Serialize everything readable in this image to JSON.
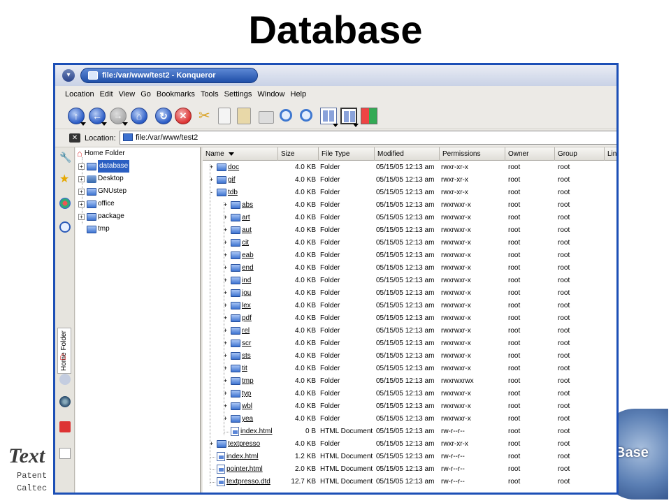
{
  "slide": {
    "title": "Database",
    "bg_left_logo": "Text",
    "bg_left_line1": "Patent",
    "bg_left_line2": "Caltec",
    "bg_right_logo": "Base"
  },
  "window": {
    "title": "file:/var/www/test2 - Konqueror",
    "menu": [
      "Location",
      "Edit",
      "View",
      "Go",
      "Bookmarks",
      "Tools",
      "Settings",
      "Window",
      "Help"
    ],
    "location_label": "Location:",
    "location_value": "file:/var/www/test2",
    "toolbar_icons": [
      "up-icon",
      "back-icon",
      "forward-icon",
      "home-icon",
      "reload-icon",
      "stop-icon",
      "cut-icon",
      "copy-icon",
      "paste-icon",
      "print-icon",
      "zoom-in-icon",
      "zoom-out-icon",
      "icon-view-icon",
      "tree-view-icon",
      "color-view-icon"
    ]
  },
  "sidebar": {
    "tab_label": "Home Folder",
    "root": "Home Folder",
    "items": [
      {
        "label": "database",
        "selected": true
      },
      {
        "label": "Desktop",
        "selected": false
      },
      {
        "label": "GNUstep",
        "selected": false
      },
      {
        "label": "office",
        "selected": false
      },
      {
        "label": "package",
        "selected": false
      },
      {
        "label": "tmp",
        "selected": false
      }
    ]
  },
  "files": {
    "columns": [
      "Name",
      "Size",
      "File Type",
      "Modified",
      "Permissions",
      "Owner",
      "Group",
      "Lin"
    ],
    "rows": [
      {
        "name": "doc",
        "size": "4.0 KB",
        "type": "Folder",
        "modified": "05/15/05 12:13 am",
        "perms": "rwxr-xr-x",
        "owner": "root",
        "group": "root",
        "level": 0,
        "kind": "folder",
        "exp": "+"
      },
      {
        "name": "gif",
        "size": "4.0 KB",
        "type": "Folder",
        "modified": "05/15/05 12:13 am",
        "perms": "rwxr-xr-x",
        "owner": "root",
        "group": "root",
        "level": 0,
        "kind": "folder",
        "exp": "+"
      },
      {
        "name": "tdb",
        "size": "4.0 KB",
        "type": "Folder",
        "modified": "05/15/05 12:13 am",
        "perms": "rwxr-xr-x",
        "owner": "root",
        "group": "root",
        "level": 0,
        "kind": "folder",
        "exp": "-"
      },
      {
        "name": "abs",
        "size": "4.0 KB",
        "type": "Folder",
        "modified": "05/15/05 12:13 am",
        "perms": "rwxrwxr-x",
        "owner": "root",
        "group": "root",
        "level": 1,
        "kind": "folder",
        "exp": "+"
      },
      {
        "name": "art",
        "size": "4.0 KB",
        "type": "Folder",
        "modified": "05/15/05 12:13 am",
        "perms": "rwxrwxr-x",
        "owner": "root",
        "group": "root",
        "level": 1,
        "kind": "folder",
        "exp": "+"
      },
      {
        "name": "aut",
        "size": "4.0 KB",
        "type": "Folder",
        "modified": "05/15/05 12:13 am",
        "perms": "rwxrwxr-x",
        "owner": "root",
        "group": "root",
        "level": 1,
        "kind": "folder",
        "exp": "+"
      },
      {
        "name": "cit",
        "size": "4.0 KB",
        "type": "Folder",
        "modified": "05/15/05 12:13 am",
        "perms": "rwxrwxr-x",
        "owner": "root",
        "group": "root",
        "level": 1,
        "kind": "folder",
        "exp": "+"
      },
      {
        "name": "eab",
        "size": "4.0 KB",
        "type": "Folder",
        "modified": "05/15/05 12:13 am",
        "perms": "rwxrwxr-x",
        "owner": "root",
        "group": "root",
        "level": 1,
        "kind": "folder",
        "exp": "+"
      },
      {
        "name": "end",
        "size": "4.0 KB",
        "type": "Folder",
        "modified": "05/15/05 12:13 am",
        "perms": "rwxrwxr-x",
        "owner": "root",
        "group": "root",
        "level": 1,
        "kind": "folder",
        "exp": "+"
      },
      {
        "name": "ind",
        "size": "4.0 KB",
        "type": "Folder",
        "modified": "05/15/05 12:13 am",
        "perms": "rwxrwxr-x",
        "owner": "root",
        "group": "root",
        "level": 1,
        "kind": "folder",
        "exp": "+"
      },
      {
        "name": "jou",
        "size": "4.0 KB",
        "type": "Folder",
        "modified": "05/15/05 12:13 am",
        "perms": "rwxrwxr-x",
        "owner": "root",
        "group": "root",
        "level": 1,
        "kind": "folder",
        "exp": "+"
      },
      {
        "name": "lex",
        "size": "4.0 KB",
        "type": "Folder",
        "modified": "05/15/05 12:13 am",
        "perms": "rwxrwxr-x",
        "owner": "root",
        "group": "root",
        "level": 1,
        "kind": "folder",
        "exp": "+"
      },
      {
        "name": "pdf",
        "size": "4.0 KB",
        "type": "Folder",
        "modified": "05/15/05 12:13 am",
        "perms": "rwxrwxr-x",
        "owner": "root",
        "group": "root",
        "level": 1,
        "kind": "folder",
        "exp": "+"
      },
      {
        "name": "rel",
        "size": "4.0 KB",
        "type": "Folder",
        "modified": "05/15/05 12:13 am",
        "perms": "rwxrwxr-x",
        "owner": "root",
        "group": "root",
        "level": 1,
        "kind": "folder",
        "exp": "+"
      },
      {
        "name": "scr",
        "size": "4.0 KB",
        "type": "Folder",
        "modified": "05/15/05 12:13 am",
        "perms": "rwxrwxr-x",
        "owner": "root",
        "group": "root",
        "level": 1,
        "kind": "folder",
        "exp": "+"
      },
      {
        "name": "sts",
        "size": "4.0 KB",
        "type": "Folder",
        "modified": "05/15/05 12:13 am",
        "perms": "rwxrwxr-x",
        "owner": "root",
        "group": "root",
        "level": 1,
        "kind": "folder",
        "exp": "+"
      },
      {
        "name": "tit",
        "size": "4.0 KB",
        "type": "Folder",
        "modified": "05/15/05 12:13 am",
        "perms": "rwxrwxr-x",
        "owner": "root",
        "group": "root",
        "level": 1,
        "kind": "folder",
        "exp": "+"
      },
      {
        "name": "tmp",
        "size": "4.0 KB",
        "type": "Folder",
        "modified": "05/15/05 12:13 am",
        "perms": "rwxrwxrwx",
        "owner": "root",
        "group": "root",
        "level": 1,
        "kind": "folder",
        "exp": "+"
      },
      {
        "name": "typ",
        "size": "4.0 KB",
        "type": "Folder",
        "modified": "05/15/05 12:13 am",
        "perms": "rwxrwxr-x",
        "owner": "root",
        "group": "root",
        "level": 1,
        "kind": "folder",
        "exp": "+"
      },
      {
        "name": "wbl",
        "size": "4.0 KB",
        "type": "Folder",
        "modified": "05/15/05 12:13 am",
        "perms": "rwxrwxr-x",
        "owner": "root",
        "group": "root",
        "level": 1,
        "kind": "folder",
        "exp": "+"
      },
      {
        "name": "yea",
        "size": "4.0 KB",
        "type": "Folder",
        "modified": "05/15/05 12:13 am",
        "perms": "rwxrwxr-x",
        "owner": "root",
        "group": "root",
        "level": 1,
        "kind": "folder",
        "exp": "+"
      },
      {
        "name": "index.html",
        "size": "0 B",
        "type": "HTML Document",
        "modified": "05/15/05 12:13 am",
        "perms": "rw-r--r--",
        "owner": "root",
        "group": "root",
        "level": 1,
        "kind": "html",
        "exp": ""
      },
      {
        "name": "textpresso",
        "size": "4.0 KB",
        "type": "Folder",
        "modified": "05/15/05 12:13 am",
        "perms": "rwxr-xr-x",
        "owner": "root",
        "group": "root",
        "level": 0,
        "kind": "folder",
        "exp": "+"
      },
      {
        "name": "index.html",
        "size": "1.2 KB",
        "type": "HTML Document",
        "modified": "05/15/05 12:13 am",
        "perms": "rw-r--r--",
        "owner": "root",
        "group": "root",
        "level": 0,
        "kind": "html",
        "exp": ""
      },
      {
        "name": "pointer.html",
        "size": "2.0 KB",
        "type": "HTML Document",
        "modified": "05/15/05 12:13 am",
        "perms": "rw-r--r--",
        "owner": "root",
        "group": "root",
        "level": 0,
        "kind": "html",
        "exp": ""
      },
      {
        "name": "textpresso.dtd",
        "size": "12.7 KB",
        "type": "HTML Document",
        "modified": "05/15/05 12:13 am",
        "perms": "rw-r--r--",
        "owner": "root",
        "group": "root",
        "level": 0,
        "kind": "html",
        "exp": ""
      }
    ]
  }
}
